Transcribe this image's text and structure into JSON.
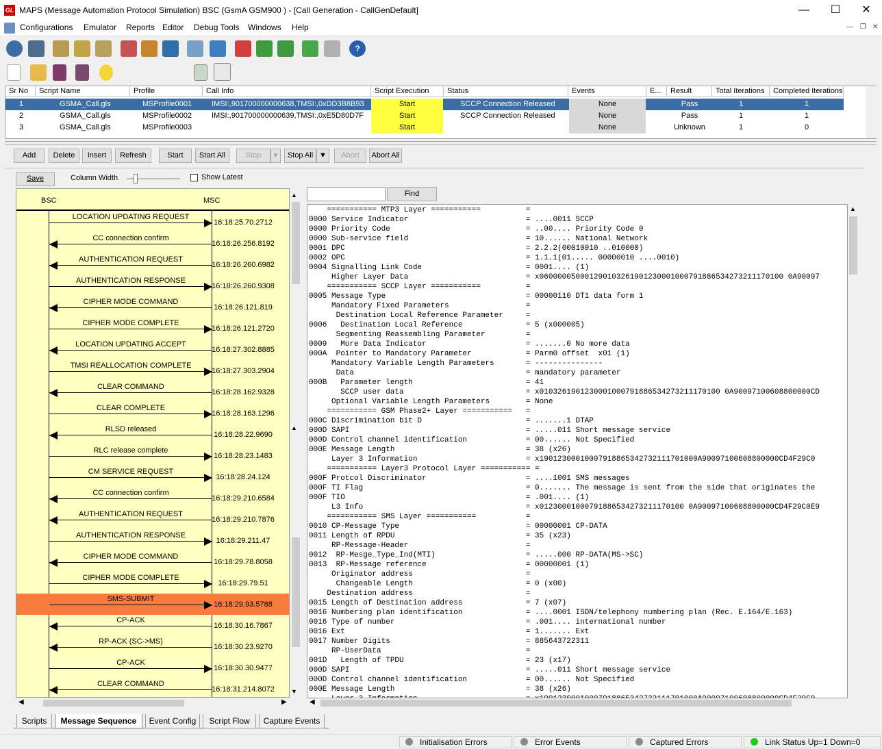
{
  "window": {
    "title": "MAPS (Message Automation Protocol Simulation) BSC (GsmA GSM900 ) - [Call Generation  - CallGenDefault]",
    "app_icon_text": "GL"
  },
  "menu": [
    "Configurations",
    "Emulator",
    "Reports",
    "Editor",
    "Debug Tools",
    "Windows",
    "Help"
  ],
  "grid": {
    "headers": [
      "Sr No",
      "Script Name",
      "Profile",
      "Call Info",
      "Script Execution",
      "Status",
      "Events",
      "E...",
      "Result",
      "Total Iterations",
      "Completed Iterations"
    ],
    "rows": [
      {
        "sr": "1",
        "script": "GSMA_Call.gls",
        "profile": "MSProfile0001",
        "info": "IMSI:,901700000000638,TMSI:,0xDD3B8B93",
        "exec": "Start",
        "status": "SCCP Connection Released",
        "events": "None",
        "result": "Pass",
        "total": "1",
        "completed": "1"
      },
      {
        "sr": "2",
        "script": "GSMA_Call.gls",
        "profile": "MSProfile0002",
        "info": "IMSI:,901700000000639,TMSI:,0xE5D80D7F",
        "exec": "Start",
        "status": "SCCP Connection Released",
        "events": "None",
        "result": "Pass",
        "total": "1",
        "completed": "1"
      },
      {
        "sr": "3",
        "script": "GSMA_Call.gls",
        "profile": "MSProfile0003",
        "info": "",
        "exec": "Start",
        "status": "",
        "events": "None",
        "result": "Unknown",
        "total": "1",
        "completed": "0"
      }
    ]
  },
  "buttons": {
    "add": "Add",
    "delete": "Delete",
    "insert": "Insert",
    "refresh": "Refresh",
    "start": "Start",
    "start_all": "Start All",
    "stop": "Stop",
    "stop_all": "Stop All",
    "abort": "Abort",
    "abort_all": "Abort All"
  },
  "seqbar": {
    "save": "Save",
    "column_width": "Column Width",
    "show_latest": "Show Latest"
  },
  "find": {
    "label": "Find",
    "value": ""
  },
  "sequence": {
    "left_col": "BSC",
    "right_col": "MSC",
    "highlight_color": "#f97c3c",
    "messages": [
      {
        "label": "LOCATION UPDATING REQUEST",
        "time": "16:18:25.70.2712",
        "dir": "right"
      },
      {
        "label": "CC connection confirm",
        "time": "16:18:26.256.8192",
        "dir": "left"
      },
      {
        "label": "AUTHENTICATION REQUEST",
        "time": "16:18:26.260.6982",
        "dir": "left"
      },
      {
        "label": "AUTHENTICATION RESPONSE",
        "time": "16:18:26.260.9308",
        "dir": "right"
      },
      {
        "label": "CIPHER MODE COMMAND",
        "time": "16:18:26.121.819",
        "dir": "left"
      },
      {
        "label": "CIPHER MODE COMPLETE",
        "time": "16:18:26.121.2720",
        "dir": "right"
      },
      {
        "label": "LOCATION UPDATING ACCEPT",
        "time": "16:18:27.302.8885",
        "dir": "left"
      },
      {
        "label": "TMSI REALLOCATION COMPLETE",
        "time": "16:18:27.303.2904",
        "dir": "right"
      },
      {
        "label": "CLEAR COMMAND",
        "time": "16:18:28.162.9328",
        "dir": "left"
      },
      {
        "label": "CLEAR COMPLETE",
        "time": "16:18:28.163.1296",
        "dir": "right"
      },
      {
        "label": "RLSD released",
        "time": "16:18:28.22.9690",
        "dir": "left"
      },
      {
        "label": "RLC release complete",
        "time": "16:18:28.23.1483",
        "dir": "right"
      },
      {
        "label": "CM SERVICE REQUEST",
        "time": "16:18:28.24.124",
        "dir": "right"
      },
      {
        "label": "CC connection confirm",
        "time": "16:18:29.210.6584",
        "dir": "left"
      },
      {
        "label": "AUTHENTICATION REQUEST",
        "time": "16:18:29.210.7876",
        "dir": "left"
      },
      {
        "label": "AUTHENTICATION RESPONSE",
        "time": "16:18:29.211.47",
        "dir": "right"
      },
      {
        "label": "CIPHER MODE COMMAND",
        "time": "16:18:29.78.8058",
        "dir": "left"
      },
      {
        "label": "CIPHER MODE COMPLETE",
        "time": "16:18:29.79.51",
        "dir": "right"
      },
      {
        "label": "SMS-SUBMIT",
        "time": "16:18:29.93.5788",
        "dir": "right",
        "highlight": true
      },
      {
        "label": "CP-ACK",
        "time": "16:18:30.16.7867",
        "dir": "left"
      },
      {
        "label": "RP-ACK (SC->MS)",
        "time": "16:18:30.23.9270",
        "dir": "left"
      },
      {
        "label": "CP-ACK",
        "time": "16:18:30.30.9477",
        "dir": "right"
      },
      {
        "label": "CLEAR COMMAND",
        "time": "16:18:31.214.8072",
        "dir": "left"
      }
    ]
  },
  "decode": [
    "    =========== MTP3 Layer ===========          =",
    "0000 Service Indicator                          = ....0011 SCCP",
    "0000 Priority Code                              = ..00.... Priority Code 0",
    "0000 Sub-service field                          = 10...... National Network",
    "0001 DPC                                        = 2.2.2(00010010 ..010000)",
    "0002 OPC                                        = 1.1.1(01..... 00000010 ....0010)",
    "0004 Signalling Link Code                       = 0001.... (1)",
    "     Higher Layer Data                          = x060000050001290103261901230001000791886534273211170100 0A90097",
    "    =========== SCCP Layer ===========          =",
    "0005 Message Type                               = 00000110 DT1 data form 1",
    "     Mandatory Fixed Parameters                 =",
    "      Destination Local Reference Parameter     =",
    "0006   Destination Local Reference              = 5 (x000005)",
    "      Segmenting Reassembling Parameter         =",
    "0009   More Data Indicator                      = .......0 No more data",
    "000A  Pointer to Mandatory Parameter            = Parm0 offset  x01 (1)",
    "     Mandatory Variable Length Parameters       = ---------------",
    "      Data                                      = mandatory parameter",
    "000B   Parameter length                         = 41",
    "       SCCP user data                           = x0103261901230001000791886534273211170100 0A90097100608800000CD",
    "     Optional Variable Length Parameters        = None",
    "    =========== GSM Phase2+ Layer ===========   =",
    "000C Discrimination bit D                       = .......1 DTAP",
    "000D SAPI                                       = .....011 Short message service",
    "000D Control channel identification             = 00...... Not Specified",
    "000E Message Length                             = 38 (x26)",
    "     Layer 3 Information                        = x19012300010007918865342732111701000A90097100608800000CD4F29C0",
    "    =========== Layer3 Protocol Layer =========== =",
    "000F Protcol Discriminator                      = ....1001 SMS messages",
    "000F TI Flag                                    = 0....... The message is sent from the side that originates the",
    "000F TIO                                        = .001.... (1)",
    "     L3 Info                                    = x01230001000791886534273211170100 0A90097100608800000CD4F29C0E9",
    "    =========== SMS Layer ===========           =",
    "0010 CP-Message Type                            = 00000001 CP-DATA",
    "0011 Length of RPDU                             = 35 (x23)",
    "     RP-Message-Header                          =",
    "0012  RP-Mesge_Type_Ind(MTI)                    = .....000 RP-DATA(MS->SC)",
    "0013  RP-Message reference                      = 00000001 (1)",
    "     Originator address                         =",
    "      Changeable Length                         = 0 (x00)",
    "    Destination address                         =",
    "0015 Length of Destination address              = 7 (x07)",
    "0016 Numbering plan identification              = ....0001 ISDN/telephony numbering plan (Rec. E.164/E.163)",
    "0016 Type of number                             = .001.... international number",
    "0016 Ext                                        = 1....... Ext",
    "0017 Number Digits                              = 885643722311",
    "     RP-UserData                                =",
    "001D   Length of TPDU                           = 23 (x17)",
    "000D SAPI                                       = .....011 Short message service",
    "000D Control channel identification             = 00...... Not Specified",
    "000E Message Length                             = 38 (x26)",
    "     Layer 3 Information                        = x19012300010007918865342732111701000A90097100608800000CD4F29C0"
  ],
  "tabs": [
    "Scripts",
    "Message Sequence",
    "Event Config",
    "Script Flow",
    "Capture Events"
  ],
  "status": {
    "init_errors": "Initialisation Errors",
    "error_events": "Error Events",
    "captured_errors": "Captured Errors",
    "link_status": "Link Status Up=1 Down=0"
  }
}
